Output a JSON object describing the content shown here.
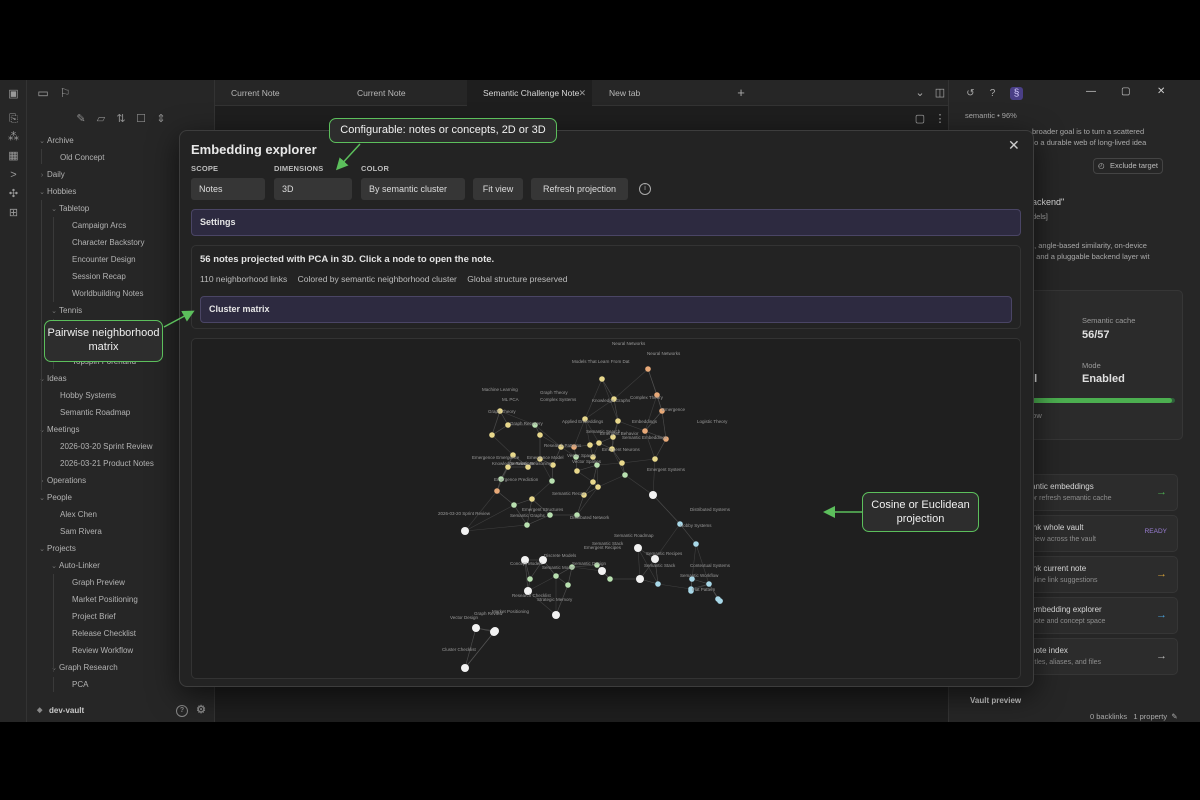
{
  "tabs": [
    {
      "label": "Current Note"
    },
    {
      "label": "Current Note"
    },
    {
      "label": "Semantic Challenge Note",
      "active": true
    },
    {
      "label": "New tab"
    }
  ],
  "tree": [
    {
      "label": "Archive",
      "folder": true,
      "level": 0
    },
    {
      "label": "Old Concept",
      "level": 1
    },
    {
      "label": "Daily",
      "folder": true,
      "level": 0,
      "collapsed": true
    },
    {
      "label": "Hobbies",
      "folder": true,
      "level": 0
    },
    {
      "label": "Tabletop",
      "folder": true,
      "level": 1
    },
    {
      "label": "Campaign Arcs",
      "level": 2
    },
    {
      "label": "Character Backstory",
      "level": 2
    },
    {
      "label": "Encounter Design",
      "level": 2
    },
    {
      "label": "Session Recap",
      "level": 2
    },
    {
      "label": "Worldbuilding Notes",
      "level": 2
    },
    {
      "label": "Tennis",
      "folder": true,
      "level": 1
    },
    {
      "label": "",
      "level": 2
    },
    {
      "label": "",
      "level": 2
    },
    {
      "label": "Topspin Forehand",
      "level": 2
    },
    {
      "label": "Ideas",
      "folder": true,
      "level": 0
    },
    {
      "label": "Hobby Systems",
      "level": 1
    },
    {
      "label": "Semantic Roadmap",
      "level": 1
    },
    {
      "label": "Meetings",
      "folder": true,
      "level": 0
    },
    {
      "label": "2026-03-20 Sprint Review",
      "level": 1
    },
    {
      "label": "2026-03-21 Product Notes",
      "level": 1
    },
    {
      "label": "Operations",
      "folder": true,
      "level": 0,
      "collapsed": true
    },
    {
      "label": "People",
      "folder": true,
      "level": 0
    },
    {
      "label": "Alex Chen",
      "level": 1
    },
    {
      "label": "Sam Rivera",
      "level": 1
    },
    {
      "label": "Projects",
      "folder": true,
      "level": 0
    },
    {
      "label": "Auto-Linker",
      "folder": true,
      "level": 1
    },
    {
      "label": "Graph Preview",
      "level": 2
    },
    {
      "label": "Market Positioning",
      "level": 2
    },
    {
      "label": "Project Brief",
      "level": 2
    },
    {
      "label": "Release Checklist",
      "level": 2
    },
    {
      "label": "Review Workflow",
      "level": 2
    },
    {
      "label": "Graph Research",
      "folder": true,
      "level": 1
    },
    {
      "label": "PCA",
      "level": 2
    }
  ],
  "vault_name": "dev-vault",
  "right": {
    "semantic_line": "semantic • 96%",
    "para1": "broader goal is to turn a scattered",
    "para2": "to a durable web of long-lived idea",
    "exclude_label": "Exclude target",
    "heading": "ackend\"",
    "tag": "dels]",
    "body1": "], angle-based similarity, on-device",
    "body2": ", and a pluggable backend layer wit",
    "cache_label": "Semantic cache",
    "cache_value": "56/57",
    "mode_label": "Mode",
    "mode_value": "Enabled",
    "left_value": "el",
    "small_label": "dow",
    "progress_fraction": 0.98,
    "actions": [
      {
        "title": "antic embeddings",
        "desc": "or refresh semantic cache",
        "arrow_color": "#4caf50"
      },
      {
        "title": "ink whole vault",
        "desc": "view across the vault",
        "badge": "READY"
      },
      {
        "title": "ink current note",
        "desc": "nline link suggestions",
        "arrow_color": "#d4a03a"
      },
      {
        "title": "embedding explorer",
        "desc": "note and concept space",
        "arrow_color": "#4a9fd6"
      },
      {
        "title": "note index",
        "desc": "titles, aliases, and files",
        "arrow_color": "#bbbbbb"
      }
    ],
    "vault_preview": "Vault preview",
    "status_backlinks": "0 backlinks",
    "status_property": "1 property"
  },
  "modal": {
    "title": "Embedding explorer",
    "scope_label": "SCOPE",
    "scope_value": "Notes",
    "dimensions_label": "DIMENSIONS",
    "dimensions_value": "3D",
    "color_label": "COLOR",
    "color_value": "By semantic cluster",
    "fit_view": "Fit view",
    "refresh": "Refresh projection",
    "settings": "Settings",
    "summary": "56 notes projected with PCA in 3D. Click a node to open the note.",
    "stats": [
      "110 neighborhood links",
      "Colored by semantic neighborhood cluster",
      "Global structure preserved"
    ],
    "cluster_matrix": "Cluster matrix"
  },
  "graph_labels": [
    "Neural Networks",
    "Neural Networks",
    "Models That Learn From Dat",
    "Machine Learning",
    "Graph Theory",
    "ML PCA",
    "Complex Systems",
    "Knowledge Graphs",
    "Complex Theory",
    "Emergence",
    "Graph Theory",
    "Graph Recovery",
    "Embeddings",
    "Logistic Theory",
    "Applied Embeddings",
    "Research Patterns",
    "Semantic Search",
    "Emergent Behavior",
    "Semantic Embeddings",
    "Emergent Systems",
    "Knowledge Relations",
    "Emergence Model",
    "Vector Spaces",
    "Vector Spaces",
    "Emergent Neurons",
    "Emergence Emergence",
    "Semantic Reasoning",
    "Emergence Prediction",
    "Semantic Recap",
    "Emergent Structures",
    "Semantic Graphs",
    "Distributed Systems",
    "2026-03-20 Sprint Review",
    "Distributed Network",
    "Semantic Roadmap",
    "Hobby Systems",
    "Semantic Stack",
    "Emergent Recipes",
    "Discrete Models",
    "Semantic Recipes",
    "Concept Models",
    "Semantic Model",
    "Semantic Design",
    "Semantic Stack",
    "Contextual Systems",
    "Semantic Workflow",
    "Flat Pattern",
    "Strategic Memory",
    "Vector Design",
    "Graph Review",
    "Cluster Checklist",
    "Market Positioning",
    "Research Checklist"
  ],
  "annotations": {
    "config": "Configurable: notes or concepts, 2D or 3D",
    "matrix": "Pairwise neighborhood matrix",
    "projection": "Cosine or Euclidean projection"
  },
  "colors": {
    "accent": "#8a74d6",
    "annotation_border": "#5cbf5c",
    "node_yellow": "#e8d88c",
    "node_orange": "#e8a978",
    "node_green": "#b8e0b0",
    "node_blue": "#a8d8e8",
    "node_white": "#f2f2f2"
  },
  "icons": {
    "ribbon": [
      "sidebar-toggle-icon",
      "files-icon",
      "graph-icon",
      "canvas-icon",
      "terminal-icon",
      "plugins-icon",
      "templates-icon"
    ],
    "left_top": [
      "folder-icon",
      "bookmark-icon"
    ],
    "nav_actions": [
      "new-note-icon",
      "new-folder-icon",
      "sort-icon",
      "collapse-icon",
      "reveal-icon"
    ]
  }
}
